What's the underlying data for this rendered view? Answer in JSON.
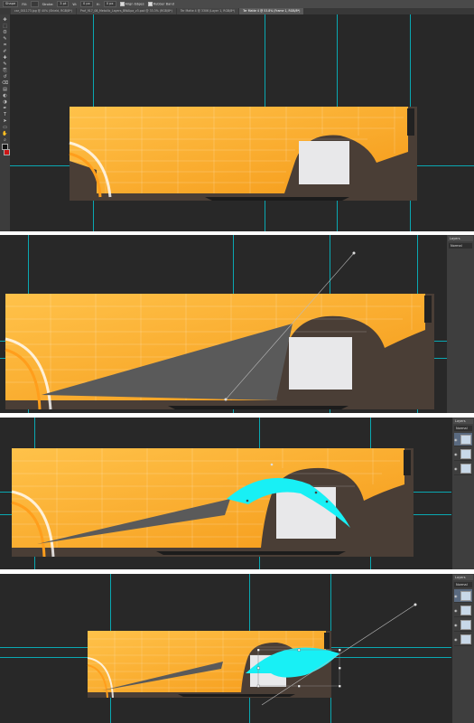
{
  "app": {
    "name": "Adobe Photoshop",
    "accent_guide_color": "#00d3e0",
    "foreground_color": "#111111",
    "background_color": "#cc1515"
  },
  "options_bar": {
    "tool_mode": "Shape",
    "fill_label": "Fill:",
    "stroke_label": "Stroke:",
    "stroke_width": "3 pt",
    "w_label": "W:",
    "w_value": "0 px",
    "h_label": "H:",
    "h_value": "0 px",
    "align_edges_label": "Align Edges",
    "rubber_band_label": "Rubber Band"
  },
  "document_tabs": [
    {
      "label": "car_001173.jpg @ 40% (Shield, RGB/8*)",
      "active": false
    },
    {
      "label": "Prof_917_08_Metallic_Layers_BWAlpa_v3.psd @ 33.3% (RGB/8*)",
      "active": false
    },
    {
      "label": "Ter Matte 4 @ 3306 (Layer 1, RGB/8*)",
      "active": false
    },
    {
      "label": "Ter Matte 4 @ 53.8% (Frame 1, RGB/8*)",
      "active": true
    }
  ],
  "tool_icons": [
    "move-tool-icon",
    "marquee-tool-icon",
    "lasso-tool-icon",
    "quick-select-tool-icon",
    "crop-tool-icon",
    "eyedropper-tool-icon",
    "healing-brush-tool-icon",
    "brush-tool-icon",
    "clone-stamp-tool-icon",
    "history-brush-tool-icon",
    "eraser-tool-icon",
    "gradient-tool-icon",
    "blur-tool-icon",
    "dodge-tool-icon",
    "pen-tool-icon",
    "type-tool-icon",
    "path-selection-tool-icon",
    "shape-tool-icon",
    "hand-tool-icon",
    "zoom-tool-icon"
  ],
  "tool_glyphs": [
    "✥",
    "⬚",
    "ʘ",
    "✎",
    "⌗",
    "✐",
    "✚",
    "✎",
    "⎘",
    "↺",
    "⌫",
    "▤",
    "◐",
    "◑",
    "✒",
    "T",
    "➤",
    "▭",
    "✋",
    "⌕"
  ],
  "right_panel": {
    "tabs": [
      "Layers",
      "Chan"
    ],
    "blend_mode": "Normal",
    "opacity_label": "Lock"
  },
  "frames": [
    {
      "id": "frame-1",
      "caption": ""
    },
    {
      "id": "frame-2",
      "caption": ""
    },
    {
      "id": "frame-3",
      "caption": ""
    },
    {
      "id": "frame-4",
      "caption": ""
    }
  ]
}
